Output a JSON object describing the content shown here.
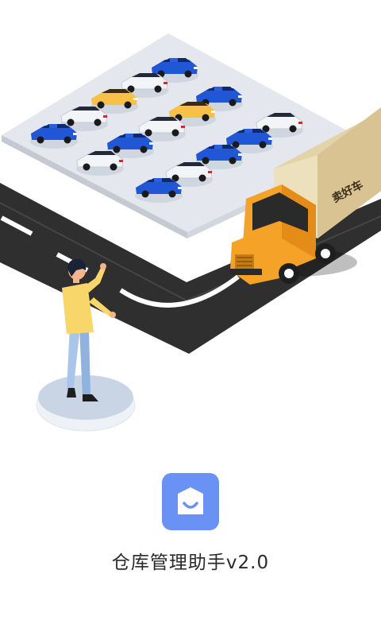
{
  "app": {
    "title": "仓库管理助手v2.0"
  },
  "truck": {
    "logo_text": "卖好车"
  },
  "icons": {
    "app_icon": "shopping-bag-icon"
  },
  "colors": {
    "app_icon_bg": "#6a92f4",
    "road": "#2f2f2f",
    "parking_lot": "#e4e7ee",
    "truck_cab": "#f4a328",
    "truck_box": "#e3d3a9",
    "car_blue": "#2156d6",
    "car_white": "#f2f4f8",
    "car_yellow": "#f6c146",
    "person_shirt": "#f8d66a",
    "person_pants": "#a9c6ea"
  }
}
